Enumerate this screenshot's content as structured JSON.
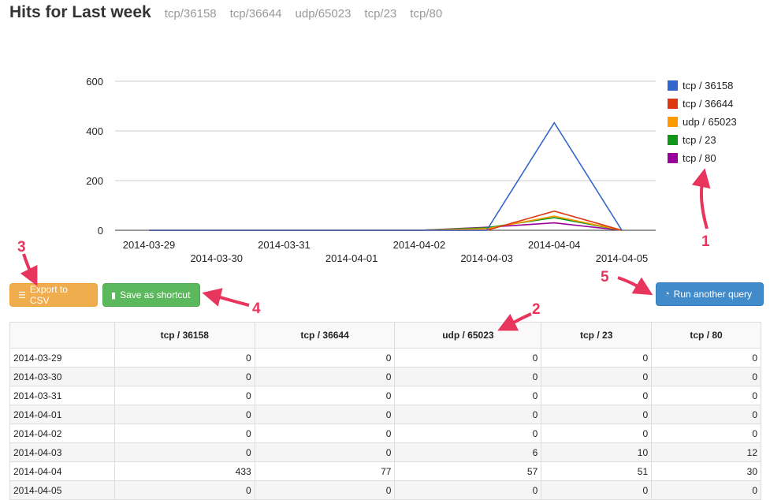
{
  "header": {
    "title": "Hits for Last week",
    "subtitles": [
      "tcp/36158",
      "tcp/36644",
      "udp/65023",
      "tcp/23",
      "tcp/80"
    ]
  },
  "colors": {
    "series": [
      "#3366cc",
      "#dc3912",
      "#ff9900",
      "#109618",
      "#990099"
    ],
    "annotation": "#e8355d"
  },
  "chart_data": {
    "type": "line",
    "x": [
      "2014-03-29",
      "2014-03-30",
      "2014-03-31",
      "2014-04-01",
      "2014-04-02",
      "2014-04-03",
      "2014-04-04",
      "2014-04-05"
    ],
    "series": [
      {
        "name": "tcp / 36158",
        "values": [
          0,
          0,
          0,
          0,
          0,
          0,
          433,
          0
        ]
      },
      {
        "name": "tcp / 36644",
        "values": [
          0,
          0,
          0,
          0,
          0,
          0,
          77,
          0
        ]
      },
      {
        "name": "udp / 65023",
        "values": [
          0,
          0,
          0,
          0,
          0,
          6,
          57,
          0
        ]
      },
      {
        "name": "tcp / 23",
        "values": [
          0,
          0,
          0,
          0,
          0,
          10,
          51,
          0
        ]
      },
      {
        "name": "tcp / 80",
        "values": [
          0,
          0,
          0,
          0,
          0,
          12,
          30,
          0
        ]
      }
    ],
    "ylim": [
      0,
      600
    ],
    "yticks": [
      0,
      200,
      400,
      600
    ],
    "grid": true,
    "legend": "right"
  },
  "buttons": {
    "export_csv": "Export to CSV",
    "save_shortcut": "Save as shortcut",
    "run_query": "Run another query"
  },
  "annotations": [
    "1",
    "2",
    "3",
    "4",
    "5"
  ],
  "table": {
    "columns": [
      "",
      "tcp / 36158",
      "tcp / 36644",
      "udp / 65023",
      "tcp / 23",
      "tcp / 80"
    ],
    "rows": [
      [
        "2014-03-29",
        "0",
        "0",
        "0",
        "0",
        "0"
      ],
      [
        "2014-03-30",
        "0",
        "0",
        "0",
        "0",
        "0"
      ],
      [
        "2014-03-31",
        "0",
        "0",
        "0",
        "0",
        "0"
      ],
      [
        "2014-04-01",
        "0",
        "0",
        "0",
        "0",
        "0"
      ],
      [
        "2014-04-02",
        "0",
        "0",
        "0",
        "0",
        "0"
      ],
      [
        "2014-04-03",
        "0",
        "0",
        "6",
        "10",
        "12"
      ],
      [
        "2014-04-04",
        "433",
        "77",
        "57",
        "51",
        "30"
      ],
      [
        "2014-04-05",
        "0",
        "0",
        "0",
        "0",
        "0"
      ]
    ]
  }
}
